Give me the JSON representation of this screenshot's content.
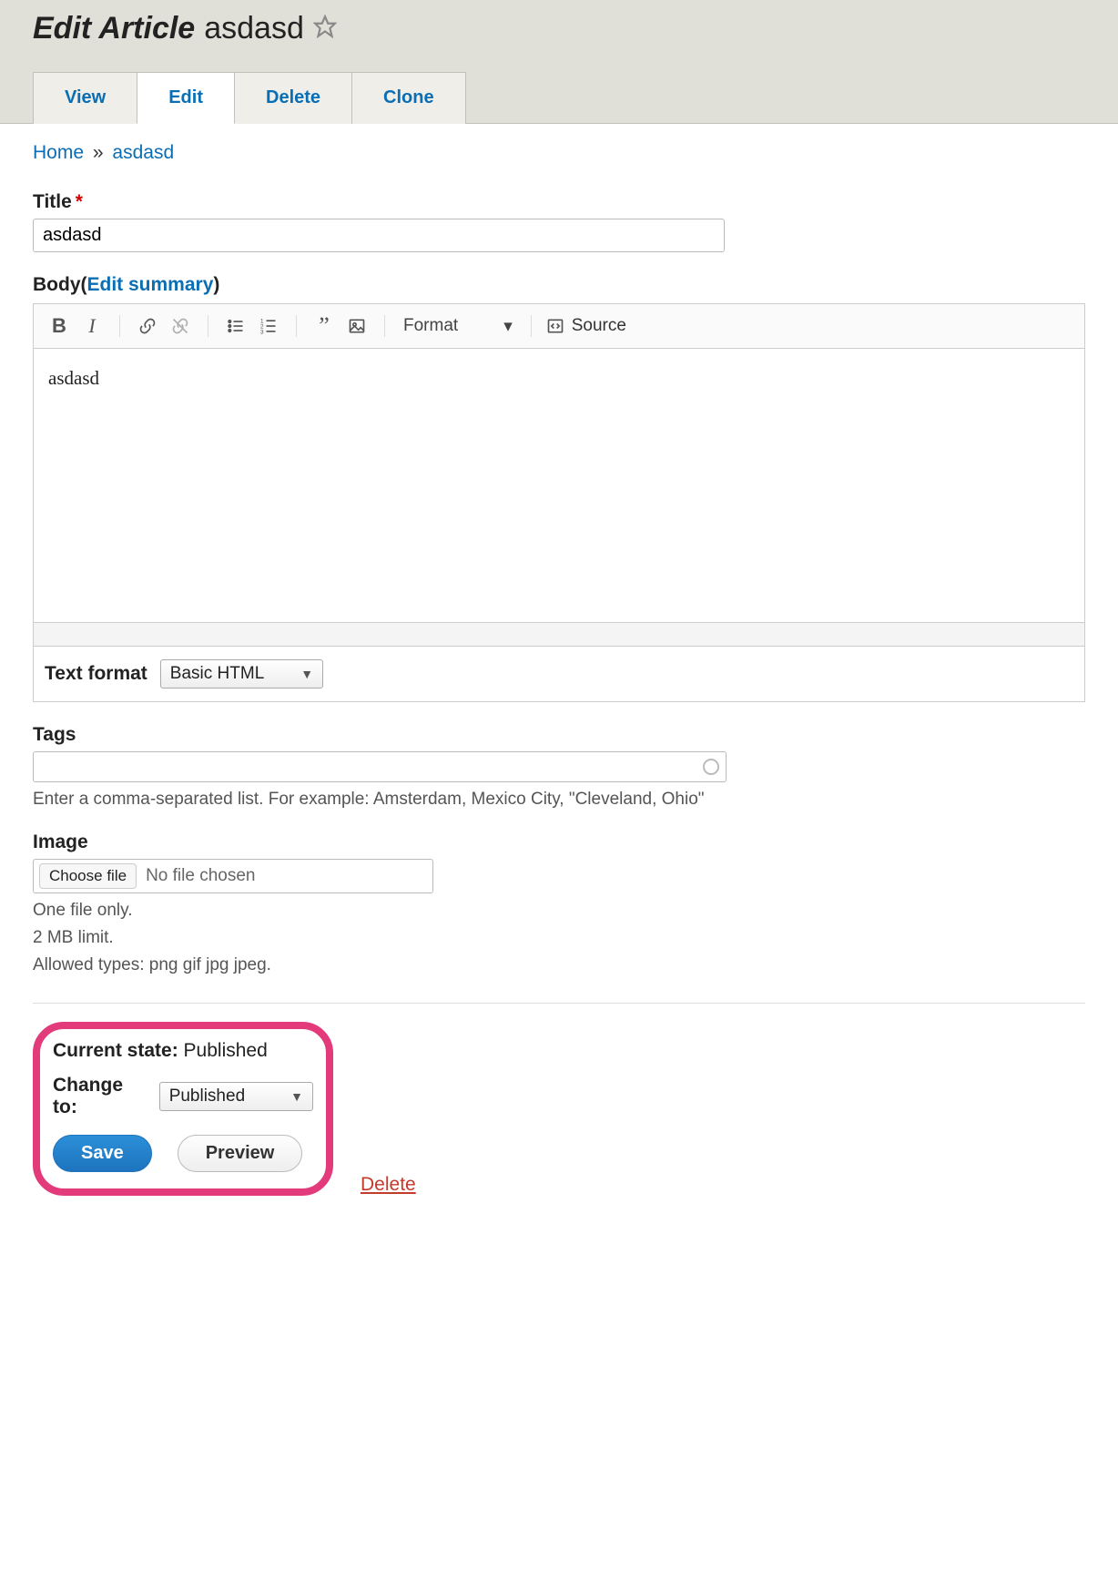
{
  "header": {
    "title_prefix": "Edit Article",
    "title_name": "asdasd"
  },
  "tabs": {
    "view": "View",
    "edit": "Edit",
    "delete": "Delete",
    "clone": "Clone"
  },
  "breadcrumb": {
    "home": "Home",
    "sep": "»",
    "current": "asdasd"
  },
  "title_field": {
    "label": "Title",
    "required_mark": "*",
    "value": "asdasd"
  },
  "body_field": {
    "label": "Body",
    "edit_summary": "Edit summary",
    "open_paren": " (",
    "close_paren": ")",
    "content": "asdasd",
    "toolbar": {
      "format_label": "Format",
      "source_label": "Source"
    }
  },
  "text_format": {
    "label": "Text format",
    "selected": "Basic HTML"
  },
  "tags": {
    "label": "Tags",
    "value": "",
    "help": "Enter a comma-separated list. For example: Amsterdam, Mexico City, \"Cleveland, Ohio\""
  },
  "image": {
    "label": "Image",
    "choose_button": "Choose file",
    "no_file": "No file chosen",
    "hint1": "One file only.",
    "hint2": "2 MB limit.",
    "hint3": "Allowed types: png gif jpg jpeg."
  },
  "moderation": {
    "current_label": "Current state:",
    "current_value": "Published",
    "change_label": "Change to:",
    "change_selected": "Published",
    "save": "Save",
    "preview": "Preview"
  },
  "delete_link": "Delete"
}
